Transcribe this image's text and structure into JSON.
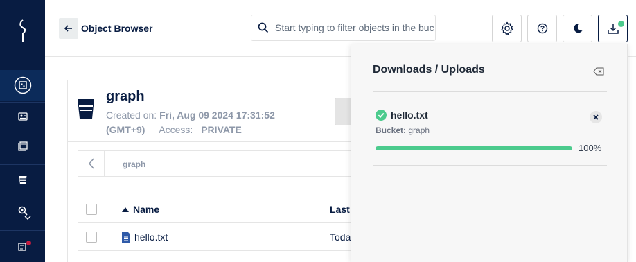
{
  "header": {
    "title": "Object Browser",
    "search_placeholder": "Start typing to filter objects in the bucket"
  },
  "sidebar": {
    "items": [
      {
        "icon": "object-browser-icon",
        "active": true
      },
      {
        "icon": "access-keys-icon"
      },
      {
        "icon": "documentation-icon"
      },
      {
        "icon": "buckets-icon"
      },
      {
        "icon": "monitoring-icon"
      },
      {
        "icon": "license-icon"
      }
    ]
  },
  "bucket": {
    "name": "graph",
    "created_label": "Created on:",
    "created_value": "Fri, Aug 09 2024 17:31:52",
    "timezone": "(GMT+9)",
    "access_label": "Access:",
    "access_value": "PRIVATE",
    "breadcrumb": "graph"
  },
  "table": {
    "columns": [
      "Name",
      "Last"
    ],
    "rows": [
      {
        "name": "hello.txt",
        "last": "Toda"
      }
    ]
  },
  "downloads": {
    "title": "Downloads / Uploads",
    "items": [
      {
        "filename": "hello.txt",
        "bucket_label": "Bucket:",
        "bucket": "graph",
        "progress": 100,
        "progress_label": "100%"
      }
    ]
  },
  "colors": {
    "sidebar": "#081c42",
    "accent_green": "#4ccb8d",
    "badge_red": "#c51b3f"
  }
}
